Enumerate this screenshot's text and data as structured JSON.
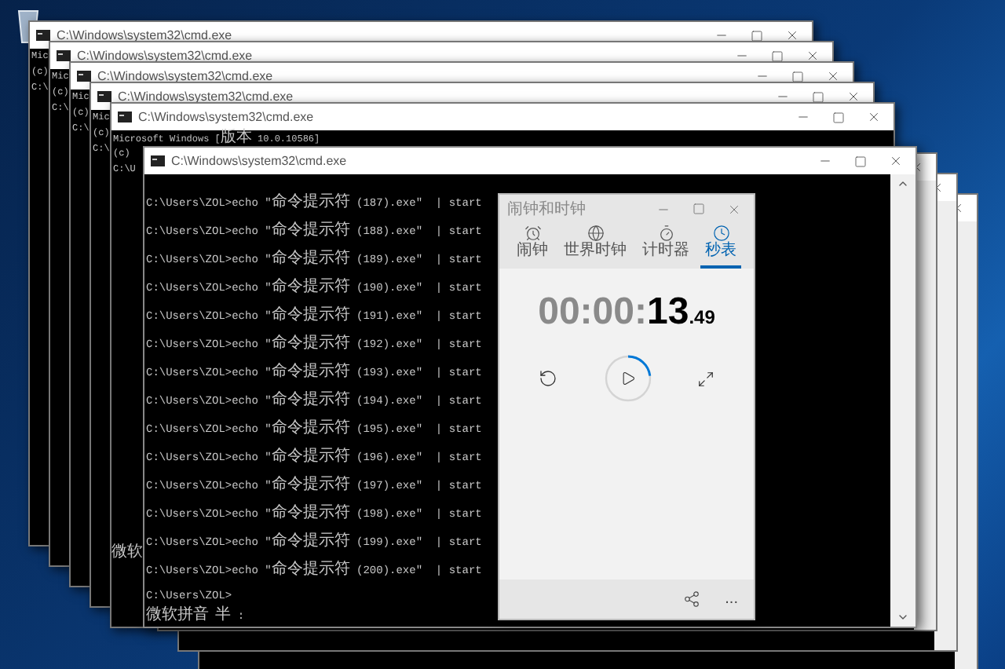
{
  "back_windows": [
    {
      "title": "C:\\Windows\\system32\\cmd.exe",
      "lines": [
        "Mic",
        "(c)",
        "C:\\"
      ]
    },
    {
      "title": "C:\\Windows\\system32\\cmd.exe",
      "lines": [
        "Mic",
        "(c)",
        "C:\\"
      ]
    },
    {
      "title": "C:\\Windows\\system32\\cmd.exe",
      "lines": [
        "Mic",
        "(c)",
        "C:\\"
      ]
    },
    {
      "title": "C:\\Windows\\system32\\cmd.exe",
      "lines": [
        "Mic",
        "(c)",
        "C:\\"
      ]
    },
    {
      "title": "C:\\Windows\\system32\\cmd.exe",
      "lines": [
        "Microsoft Windows [版本 10.0.10586]",
        "(c)",
        "C:\\U"
      ],
      "footer": "微软"
    }
  ],
  "front_window": {
    "title": "C:\\Windows\\system32\\cmd.exe",
    "lines": [
      "C:\\Users\\ZOL>echo \"命令提示符 (187).exe\"  | start",
      "C:\\Users\\ZOL>echo \"命令提示符 (188).exe\"  | start",
      "C:\\Users\\ZOL>echo \"命令提示符 (189).exe\"  | start",
      "C:\\Users\\ZOL>echo \"命令提示符 (190).exe\"  | start",
      "C:\\Users\\ZOL>echo \"命令提示符 (191).exe\"  | start",
      "C:\\Users\\ZOL>echo \"命令提示符 (192).exe\"  | start",
      "C:\\Users\\ZOL>echo \"命令提示符 (193).exe\"  | start",
      "C:\\Users\\ZOL>echo \"命令提示符 (194).exe\"  | start",
      "C:\\Users\\ZOL>echo \"命令提示符 (195).exe\"  | start",
      "C:\\Users\\ZOL>echo \"命令提示符 (196).exe\"  | start",
      "C:\\Users\\ZOL>echo \"命令提示符 (197).exe\"  | start",
      "C:\\Users\\ZOL>echo \"命令提示符 (198).exe\"  | start",
      "C:\\Users\\ZOL>echo \"命令提示符 (199).exe\"  | start",
      "C:\\Users\\ZOL>echo \"命令提示符 (200).exe\"  | start"
    ],
    "prompt": "C:\\Users\\ZOL>",
    "ime_status": "微软拼音 半 :"
  },
  "clock_app": {
    "title": "闹钟和时钟",
    "tabs": [
      {
        "label": "闹钟",
        "kind": "alarm",
        "selected": false
      },
      {
        "label": "世界时钟",
        "kind": "world",
        "selected": false
      },
      {
        "label": "计时器",
        "kind": "timer",
        "selected": false
      },
      {
        "label": "秒表",
        "kind": "stopwatch",
        "selected": true
      }
    ],
    "time": {
      "hours_minutes": "00:00:",
      "seconds": "13",
      "fraction": ".49"
    },
    "progress": {
      "level": 0.23
    },
    "more": "..."
  }
}
